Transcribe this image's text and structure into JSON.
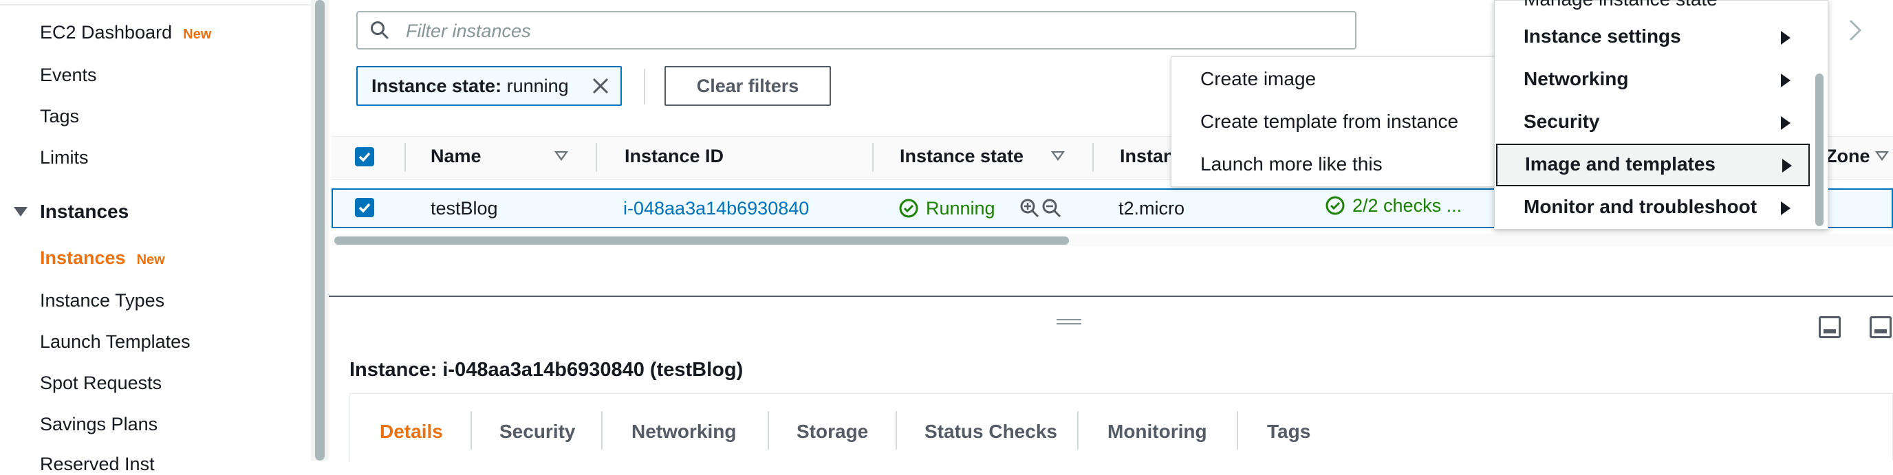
{
  "sidebar": {
    "ec2_dashboard": "EC2 Dashboard",
    "new_badge": "New",
    "events": "Events",
    "tags": "Tags",
    "limits": "Limits",
    "instances_section": "Instances",
    "instances": "Instances",
    "instance_types": "Instance Types",
    "launch_templates": "Launch Templates",
    "spot_requests": "Spot Requests",
    "savings_plans": "Savings Plans",
    "reserved_instances_partial": "Reserved Inst"
  },
  "filter": {
    "placeholder": "Filter instances",
    "chip_key": "Instance state:",
    "chip_value": "running",
    "clear_label": "Clear filters"
  },
  "table": {
    "columns": {
      "name": "Name",
      "instance_id": "Instance ID",
      "instance_state": "Instance state",
      "instance_type_partial": "Instan",
      "zone_partial": "Zone"
    },
    "row": {
      "name": "testBlog",
      "instance_id": "i-048aa3a14b6930840",
      "state": "Running",
      "type": "t2.micro",
      "checks": "2/2 checks ..."
    }
  },
  "details": {
    "title": "Instance: i-048aa3a14b6930840 (testBlog)",
    "tabs": [
      "Details",
      "Security",
      "Networking",
      "Storage",
      "Status Checks",
      "Monitoring",
      "Tags"
    ],
    "active_tab": "Details"
  },
  "context_menu": {
    "partial_top": "Manage instance state",
    "items": [
      {
        "label": "Instance settings"
      },
      {
        "label": "Networking"
      },
      {
        "label": "Security"
      },
      {
        "label": "Image and templates",
        "highlighted": true
      },
      {
        "label": "Monitor and troubleshoot"
      }
    ]
  },
  "submenu": {
    "items": [
      "Create image",
      "Create template from instance",
      "Launch more like this"
    ]
  },
  "icons": {
    "search": "search-icon",
    "close": "close-icon",
    "sort": "sort-caret-icon",
    "running": "check-circle-icon",
    "zoom_in": "zoom-in-icon",
    "zoom_out": "zoom-out-icon",
    "checks": "check-circle-icon",
    "submenu_arrow": "caret-right-icon",
    "next": "chevron-right-icon"
  },
  "colors": {
    "accent_orange": "#ec7211",
    "link_blue": "#0073bb",
    "success_green": "#1d8102"
  }
}
